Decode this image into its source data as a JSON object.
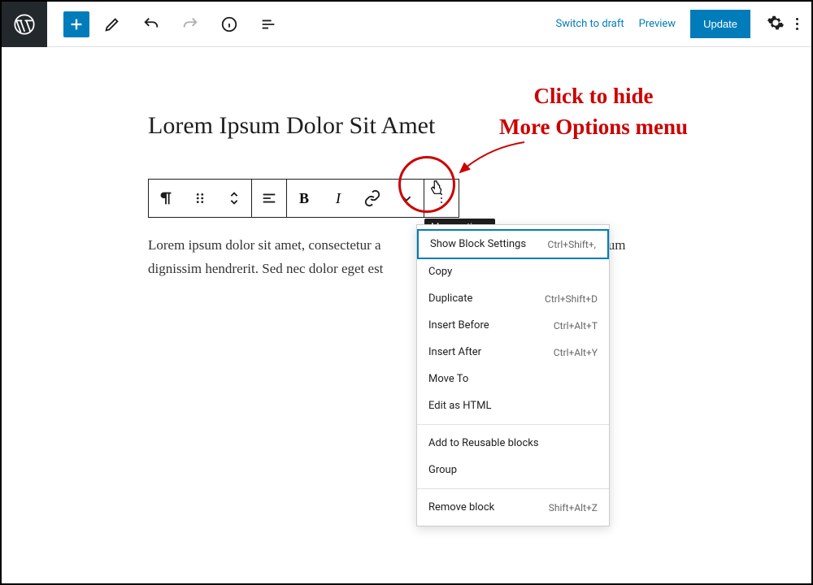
{
  "topbar": {
    "switch_draft": "Switch to draft",
    "preview": "Preview",
    "update": "Update"
  },
  "post": {
    "title": "Lorem Ipsum Dolor Sit Amet",
    "paragraph_visible": "Lorem ipsum dolor sit amet, consectetur a",
    "paragraph_line2_prefix": "dignissim hendrerit. Sed nec dolor eget est",
    "paragraph_covered_right": "s ipsum"
  },
  "block_toolbar": {
    "bold_label": "B",
    "italic_label": "I",
    "more_tooltip": "More options"
  },
  "menu": {
    "sections": [
      {
        "items": [
          {
            "label": "Show Block Settings",
            "shortcut": "Ctrl+Shift+,",
            "highlighted": true
          },
          {
            "label": "Copy",
            "shortcut": ""
          },
          {
            "label": "Duplicate",
            "shortcut": "Ctrl+Shift+D"
          },
          {
            "label": "Insert Before",
            "shortcut": "Ctrl+Alt+T"
          },
          {
            "label": "Insert After",
            "shortcut": "Ctrl+Alt+Y"
          },
          {
            "label": "Move To",
            "shortcut": ""
          },
          {
            "label": "Edit as HTML",
            "shortcut": ""
          }
        ]
      },
      {
        "items": [
          {
            "label": "Add to Reusable blocks",
            "shortcut": ""
          },
          {
            "label": "Group",
            "shortcut": ""
          }
        ]
      },
      {
        "items": [
          {
            "label": "Remove block",
            "shortcut": "Shift+Alt+Z"
          }
        ]
      }
    ]
  },
  "annotation": {
    "line1": "Click to hide",
    "line2": "More Options menu"
  },
  "colors": {
    "wp_blue": "#007cba",
    "anno_red": "#cc0000"
  }
}
